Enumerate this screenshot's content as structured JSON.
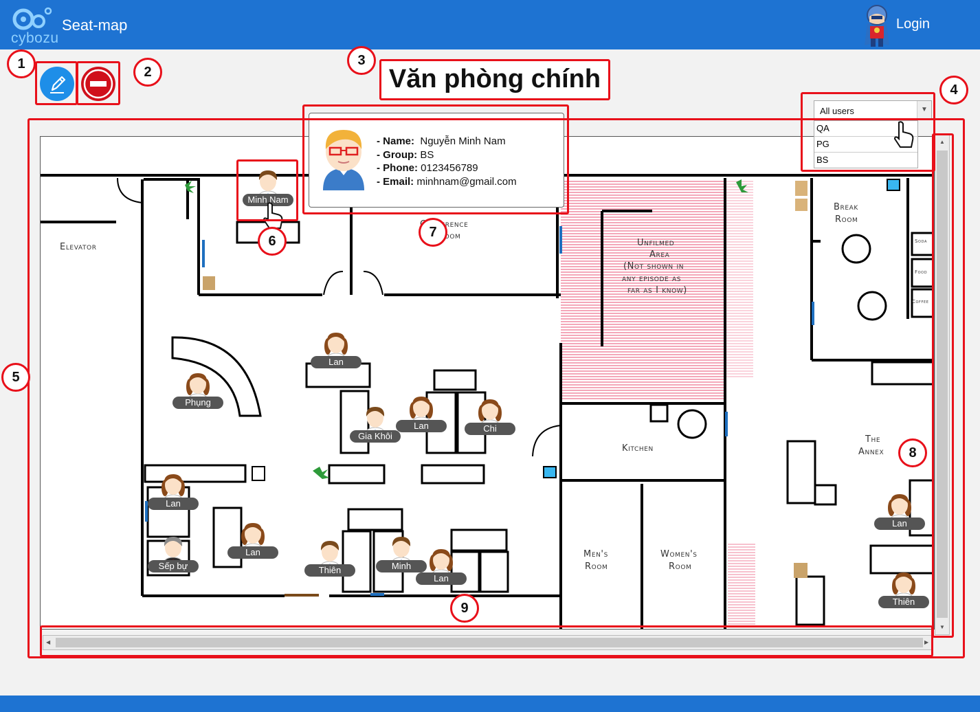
{
  "header": {
    "logo_text": "cybozu",
    "app_title": "Seat-map",
    "login_label": "Login"
  },
  "toolbar": {
    "edit_icon": "pencil-icon",
    "delete_icon": "no-entry-icon"
  },
  "floor": {
    "title": "Văn phòng chính"
  },
  "group_filter": {
    "selected": "All users",
    "options": [
      "QA",
      "PG",
      "BS"
    ]
  },
  "user_popup": {
    "name_label": "- Name:",
    "name": "Nguyễn Minh Nam",
    "group_label": "- Group:",
    "group": "BS",
    "phone_label": "- Phone:",
    "phone": "0123456789",
    "email_label": "- Email:",
    "email": "minhnam@gmail.com"
  },
  "rooms": {
    "elevator": "Elevator",
    "conference": [
      "Conference",
      "Room"
    ],
    "unfilmed": [
      "Unfilmed",
      "Area",
      "(Not shown in",
      "any episode as",
      "far as I know)"
    ],
    "break_room": [
      "Break",
      "Room"
    ],
    "soda": "Soda",
    "food": "Food",
    "coffee": "Coffee",
    "kitchen": "Kitchen",
    "annex": [
      "The",
      "Annex"
    ],
    "mens": [
      "Men's",
      "Room"
    ],
    "womens": [
      "Women's",
      "Room"
    ]
  },
  "seats": [
    {
      "name": "Minh Nam",
      "gender": "male"
    },
    {
      "name": "Lan",
      "gender": "female"
    },
    {
      "name": "Phụng",
      "gender": "female"
    },
    {
      "name": "Gia Khôi",
      "gender": "male"
    },
    {
      "name": "Lan",
      "gender": "female"
    },
    {
      "name": "Chi",
      "gender": "female"
    },
    {
      "name": "Lan",
      "gender": "female"
    },
    {
      "name": "Sếp bự",
      "gender": "boss"
    },
    {
      "name": "Lan",
      "gender": "female"
    },
    {
      "name": "Thiên",
      "gender": "male"
    },
    {
      "name": "Minh",
      "gender": "male"
    },
    {
      "name": "Lan",
      "gender": "female"
    },
    {
      "name": "Lan",
      "gender": "female"
    },
    {
      "name": "Thiên",
      "gender": "female"
    }
  ],
  "annotations": [
    "1",
    "2",
    "3",
    "4",
    "5",
    "6",
    "7",
    "8",
    "9"
  ],
  "colors": {
    "header": "#1e73d2",
    "annotation": "#e8101a",
    "edit_button": "#1e8ee8",
    "delete_button": "#d0101b",
    "seat_label": "#555555",
    "unfilmed_area": "#f4a7b9"
  }
}
